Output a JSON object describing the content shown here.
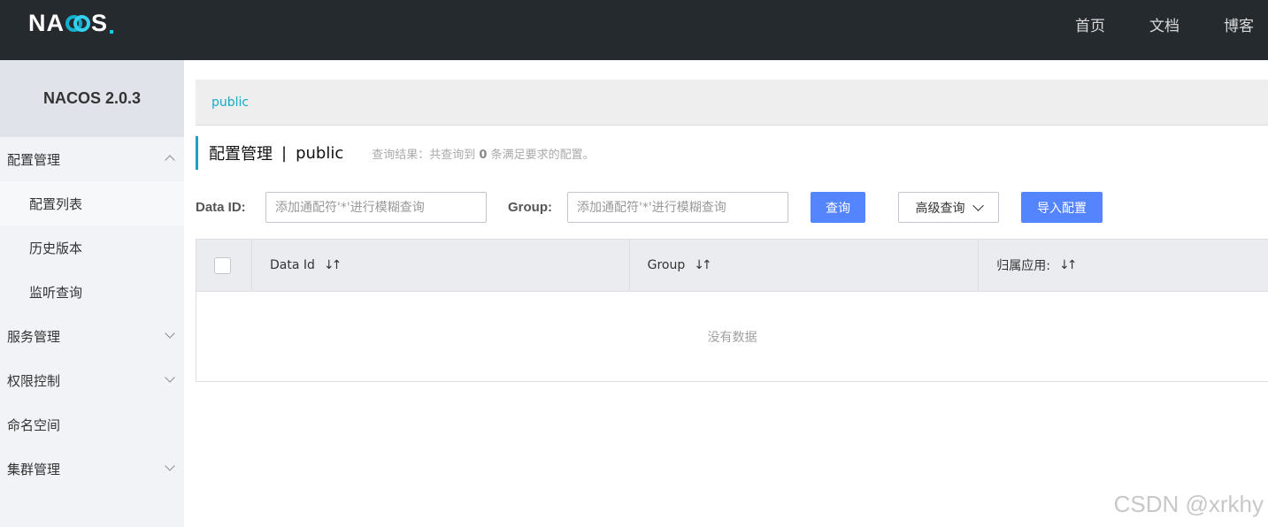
{
  "header": {
    "logo_left": "NA",
    "logo_right": "S",
    "nav": [
      "首页",
      "文档",
      "博客"
    ]
  },
  "sidebar": {
    "version": "NACOS 2.0.3",
    "groups": [
      {
        "label": "配置管理",
        "expanded": true,
        "items": [
          "配置列表",
          "历史版本",
          "监听查询"
        ],
        "active": "配置列表"
      },
      {
        "label": "服务管理",
        "expanded": false
      },
      {
        "label": "权限控制",
        "expanded": false
      },
      {
        "label": "命名空间",
        "expanded": false
      },
      {
        "label": "集群管理",
        "expanded": false
      }
    ]
  },
  "main": {
    "namespace_tab": "public",
    "title": "配置管理",
    "title_sep": "|",
    "title_ns": "public",
    "result_prefix": "查询结果：共查询到",
    "result_count": "0",
    "result_suffix": "条满足要求的配置。",
    "filter": {
      "data_id_label": "Data ID:",
      "data_id_placeholder": "添加通配符'*'进行模糊查询",
      "group_label": "Group:",
      "group_placeholder": "添加通配符'*'进行模糊查询",
      "query_button": "查询",
      "advanced_button": "高级查询",
      "import_button": "导入配置"
    },
    "table": {
      "columns": [
        "Data Id",
        "Group",
        "归属应用:"
      ],
      "empty_text": "没有数据"
    }
  },
  "watermark": "CSDN @xrkhy",
  "colors": {
    "header_bg": "#252a2f",
    "primary": "#5584ff",
    "accent": "#1aa1c8"
  }
}
